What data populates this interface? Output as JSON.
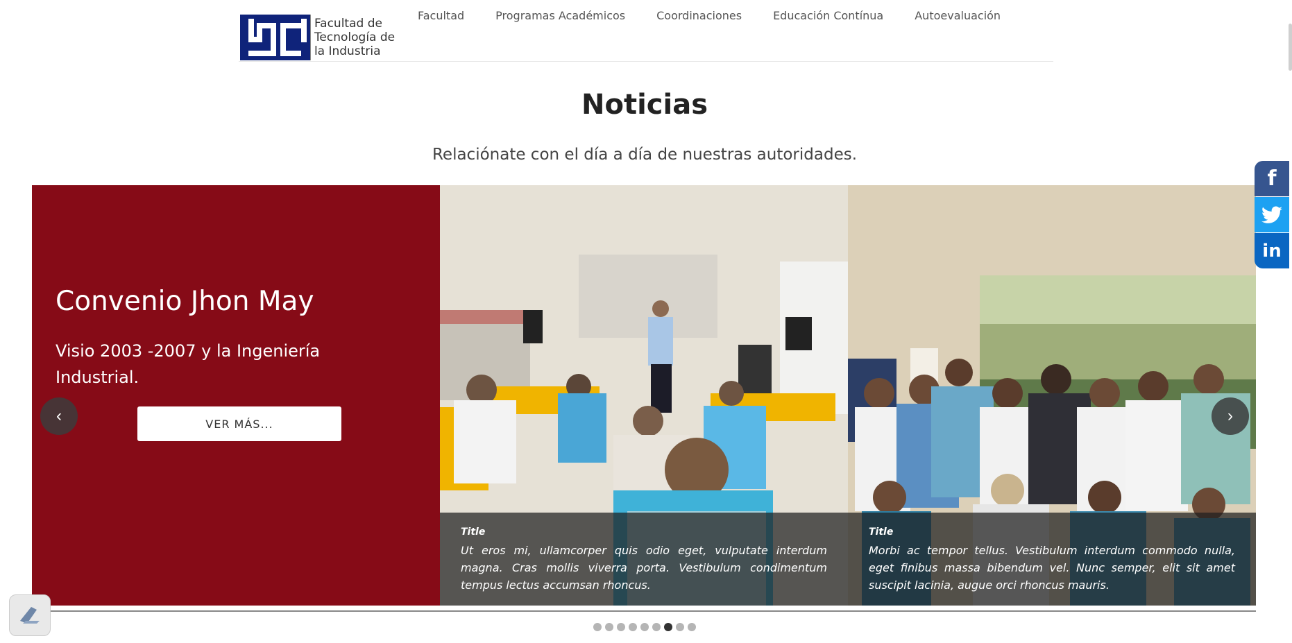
{
  "header": {
    "logo_text": "Facultad de Tecnología de la Industria",
    "nav": [
      "Facultad",
      "Programas Académicos",
      "Coordinaciones",
      "Educación Contínua",
      "Autoevaluación"
    ]
  },
  "section": {
    "title": "Noticias",
    "subtitle": "Relaciónate con el día a día de nuestras autoridades."
  },
  "carousel": {
    "featured": {
      "title": "Convenio Jhon May",
      "text": "Visio 2003 -2007 y la Ingeniería Industrial.",
      "button": "VER MÁS..."
    },
    "cards": [
      {
        "caption_title": "Title",
        "caption_text": "Ut eros mi, ullamcorper quis odio eget, vulputate interdum magna. Cras mollis viverra porta. Vestibulum condimentum tempus lectus accumsan rhoncus."
      },
      {
        "caption_title": "Title",
        "caption_text": "Morbi ac tempor tellus. Vestibulum interdum commodo nulla, eget finibus massa bibendum vel. Nunc semper, elit sit amet suscipit lacinia, augue orci rhoncus mauris."
      }
    ],
    "prev_glyph": "‹",
    "next_glyph": "›",
    "dot_count": 9,
    "active_dot": 7
  },
  "social": {
    "facebook_glyph": "f",
    "twitter_glyph": "🐦",
    "linkedin_glyph": "in"
  },
  "colors": {
    "featured_bg": "#860b17",
    "logo_blue": "#0f237a",
    "facebook": "#36558f",
    "twitter": "#1da1f2",
    "linkedin": "#0a66c2"
  }
}
